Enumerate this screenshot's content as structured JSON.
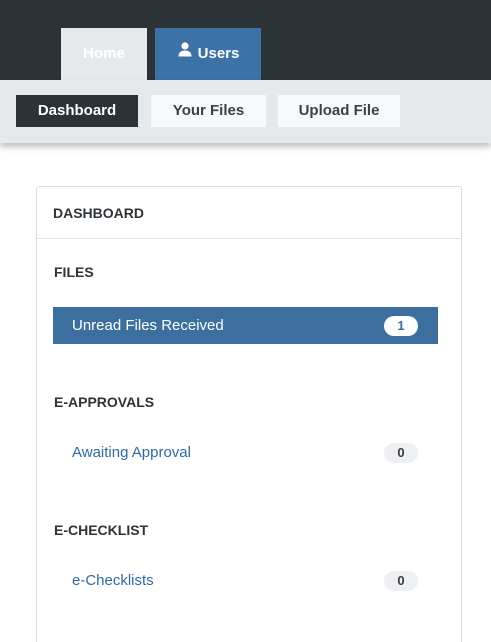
{
  "topnav": {
    "tabs": [
      {
        "label": "Home",
        "icon": "home"
      },
      {
        "label": "Users",
        "icon": "user-icon"
      }
    ]
  },
  "subnav": {
    "buttons": [
      {
        "label": "Dashboard",
        "active": true
      },
      {
        "label": "Your Files"
      },
      {
        "label": "Upload File"
      }
    ]
  },
  "panel": {
    "title": "DASHBOARD",
    "sections": [
      {
        "title": "FILES",
        "items": [
          {
            "label": "Unread Files Received",
            "count": "1",
            "active": true
          }
        ]
      },
      {
        "title": "E-APPROVALS",
        "items": [
          {
            "label": "Awaiting Approval",
            "count": "0"
          }
        ]
      },
      {
        "title": "E-CHECKLIST",
        "items": [
          {
            "label": "e-Checklists",
            "count": "0"
          }
        ]
      }
    ]
  },
  "colors": {
    "topbar": "#2b3238",
    "accent": "#3c72a6",
    "active_row": "#3c6f9e",
    "link": "#2f6aa1"
  }
}
